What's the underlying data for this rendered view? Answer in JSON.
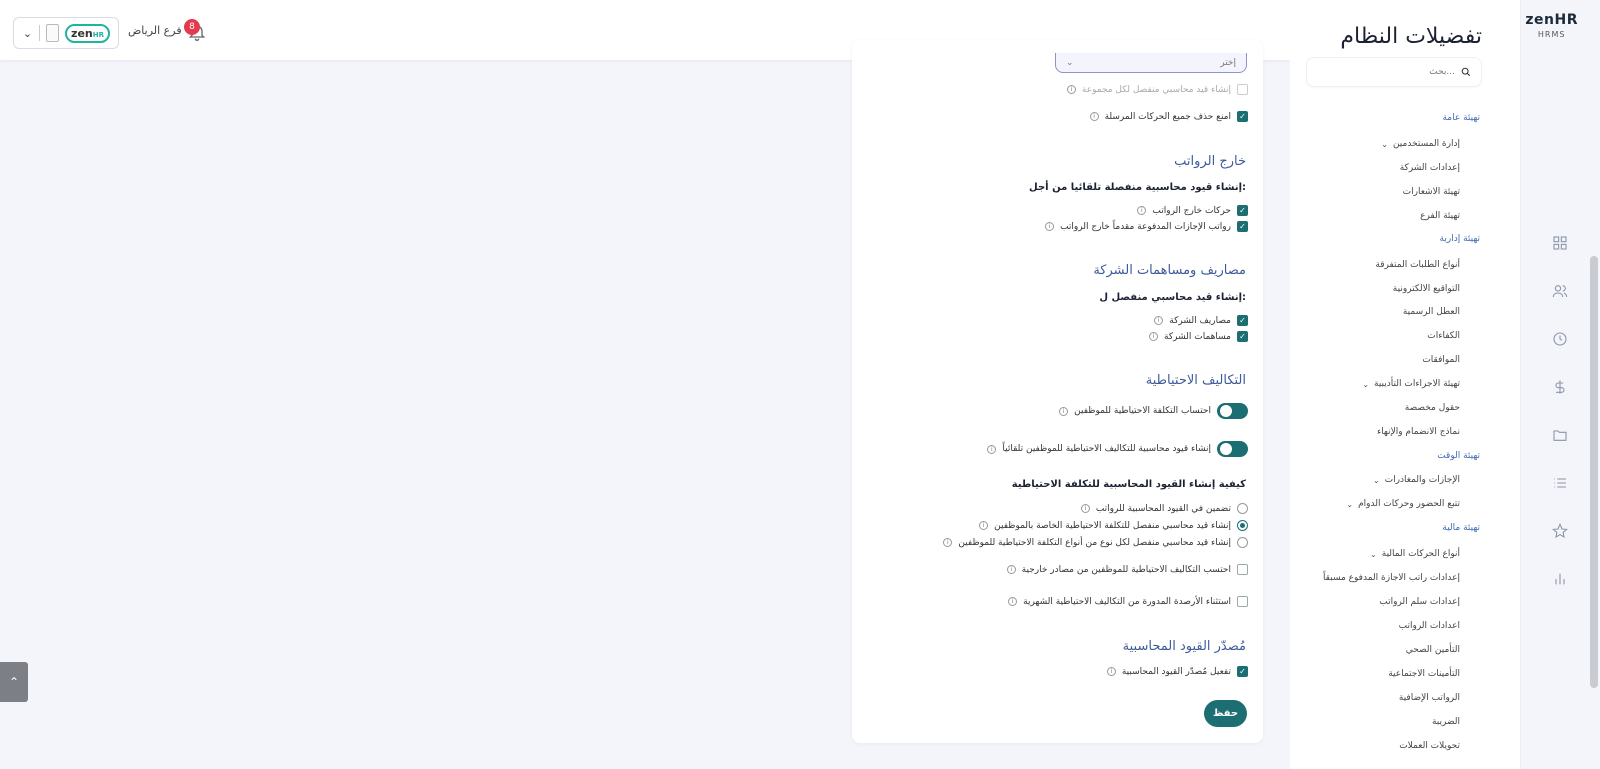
{
  "header": {
    "branch_name": "فرع الرياض",
    "notifications_count": "8",
    "tenant_logo": "zenHR"
  },
  "brand": {
    "name": "zenHR",
    "sub": "HRMS"
  },
  "sidebar": {
    "title": "تفضيلات النظام",
    "search_placeholder": "بحث...",
    "items": [
      {
        "label": "تهيئة عامة",
        "section": true
      },
      {
        "label": "إدارة المستخدمين",
        "chevron": true
      },
      {
        "label": "إعدادات الشركة"
      },
      {
        "label": "تهيئة الاشعارات"
      },
      {
        "label": "تهيئة الفرع"
      },
      {
        "label": "تهيئة إدارية",
        "section": true
      },
      {
        "label": "أنواع الطلبات المتفرقة"
      },
      {
        "label": "التواقيع الالكترونية"
      },
      {
        "label": "العطل الرسمية"
      },
      {
        "label": "الكفاءات"
      },
      {
        "label": "الموافقات"
      },
      {
        "label": "تهيئة الاجراءات التأديبية",
        "chevron": true
      },
      {
        "label": "حقول مخصصة"
      },
      {
        "label": "نماذج الانضمام والإنهاء"
      },
      {
        "label": "تهيئة الوقت",
        "section": true
      },
      {
        "label": "الإجازات والمغادرات",
        "chevron": true
      },
      {
        "label": "تتبع الحضور وحركات الدوام",
        "chevron": true
      },
      {
        "label": "تهيئة مالية",
        "section": true
      },
      {
        "label": "أنواع الحركات المالية",
        "chevron": true
      },
      {
        "label": "إعدادات راتب الاجازة المدفوع مسبقاً"
      },
      {
        "label": "إعدادات سلم الرواتب"
      },
      {
        "label": "اعدادات الرواتب"
      },
      {
        "label": "التأمين الصحي"
      },
      {
        "label": "التأمينات الاجتماعية"
      },
      {
        "label": "الرواتب الإضافية"
      },
      {
        "label": "الضريبة"
      },
      {
        "label": "تحويلات العملات"
      }
    ]
  },
  "main": {
    "select_value": "إختر",
    "top_checks": [
      {
        "label": "إنشاء قيد محاسبي منفصل لكل مجموعة",
        "checked": false,
        "disabled": true
      },
      {
        "label": "امنع حذف جميع الحركات المرسلة",
        "checked": true
      }
    ],
    "off_payroll": {
      "title": "خارج الرواتب",
      "subtitle": "إنشاء قيود محاسبية منفصلة تلقائيا من أجل:",
      "checks": [
        {
          "label": "حركات خارج الرواتب",
          "checked": true
        },
        {
          "label": "رواتب الإجازات المدفوعة مقدماً خارج الرواتب",
          "checked": true
        }
      ]
    },
    "company_costs": {
      "title": "مصاريف ومساهمات الشركة",
      "subtitle": "إنشاء قيد محاسبي منفصل ل:",
      "checks": [
        {
          "label": "مصاريف الشركة",
          "checked": true
        },
        {
          "label": "مساهمات الشركة",
          "checked": true
        }
      ]
    },
    "accruals": {
      "title": "التكاليف الاحتياطية",
      "toggles": [
        {
          "label": "احتساب التكلفة الاحتياطية للموظفين",
          "on": true
        },
        {
          "label": "إنشاء قيود محاسبية للتكاليف الاحتياطية للموظفين تلقائياً",
          "on": true
        }
      ],
      "how_title": "كيفية إنشاء القيود المحاسبية للتكلفة الاحتياطية",
      "radios": [
        {
          "label": "تضمين في القيود المحاسبية للرواتب",
          "selected": false
        },
        {
          "label": "إنشاء قيد محاسبي منفصل للتكلفة الاحتياطية الخاصة بالموظفين",
          "selected": true
        },
        {
          "label": "إنشاء قيد محاسبي منفصل لكل نوع من أنواع التكلفة الاحتياطية للموظفين",
          "selected": false
        }
      ],
      "extra_checks": [
        {
          "label": "احتسب التكاليف الاحتياطية للموظفين من مصادر خارجية",
          "checked": false
        },
        {
          "label": "استثناء الأرصدة المدورة من التكاليف الاحتياطية الشهرية",
          "checked": false
        }
      ]
    },
    "journal_export": {
      "title": "مُصدّر القيود المحاسبية",
      "checks": [
        {
          "label": "تفعيل مُصدّر القيود المحاسبية",
          "checked": true
        }
      ]
    },
    "save_label": "حفظ"
  },
  "colors": {
    "primary": "#1d6e72",
    "section": "#3d5b9a",
    "badge": "#e53950"
  }
}
